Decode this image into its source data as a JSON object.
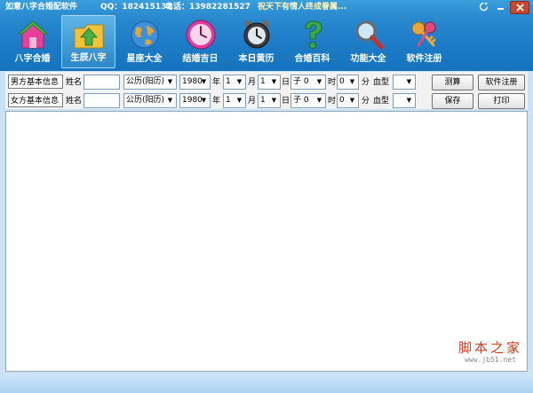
{
  "titlebar": {
    "app_title": "如意八字合婚配软件",
    "qq": "QQ：182415132",
    "phone": "电话：13982281527",
    "slogan": "祝天下有情人终成眷属..."
  },
  "nav": {
    "items": [
      {
        "label": "八字合婚",
        "icon": "house-icon"
      },
      {
        "label": "生辰八字",
        "icon": "folder-up-icon"
      },
      {
        "label": "星座大全",
        "icon": "globe-icon"
      },
      {
        "label": "结婚吉日",
        "icon": "clock-icon"
      },
      {
        "label": "本日黄历",
        "icon": "alarm-clock-icon"
      },
      {
        "label": "合婚百科",
        "icon": "question-icon"
      },
      {
        "label": "功能大全",
        "icon": "magnifier-icon"
      },
      {
        "label": "软件注册",
        "icon": "keys-icon"
      }
    ],
    "active_index": 1
  },
  "form": {
    "male": {
      "group_label": "男方基本信息",
      "name_label": "姓名",
      "name_value": "",
      "calendar": "公历(阳历)",
      "year": "1980",
      "year_label": "年",
      "month": "1",
      "month_label": "月",
      "day": "1",
      "day_label": "日",
      "hour": "子 0",
      "hour_label": "时",
      "minute": "0",
      "minute_label": "分",
      "blood_label": "血型",
      "blood_value": "",
      "btn_left": "测算",
      "btn_right": "软件注册"
    },
    "female": {
      "group_label": "女方基本信息",
      "name_label": "姓名",
      "name_value": "",
      "calendar": "公历(阳历)",
      "year": "1980",
      "year_label": "年",
      "month": "1",
      "month_label": "月",
      "day": "1",
      "day_label": "日",
      "hour": "子 0",
      "hour_label": "时",
      "minute": "0",
      "minute_label": "分",
      "blood_label": "血型",
      "blood_value": "",
      "btn_left": "保存",
      "btn_right": "打印"
    }
  },
  "output": {
    "content": ""
  },
  "watermark": {
    "text": "脚本之家",
    "url": "www.jb51.net"
  },
  "colors": {
    "banner": "#1e7cc6",
    "panel": "#f2f2f2",
    "statusbar": "#a9d1ef",
    "watermark": "#d23a18"
  }
}
